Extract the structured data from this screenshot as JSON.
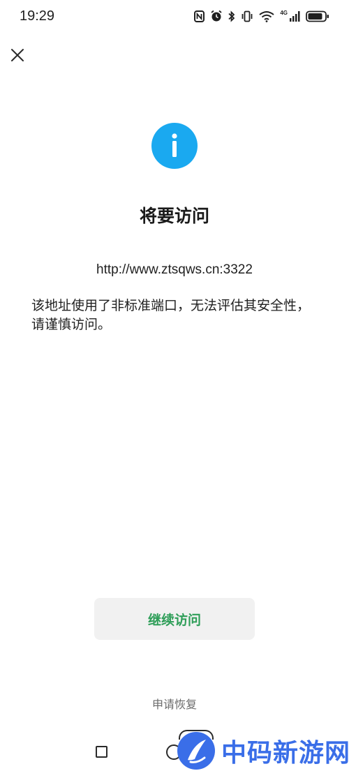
{
  "status_bar": {
    "time": "19:29",
    "network_label": "4G",
    "icons": [
      "nfc-icon",
      "alarm-icon",
      "bluetooth-icon",
      "vibrate-icon",
      "wifi-icon",
      "cellular-signal-icon",
      "battery-icon"
    ]
  },
  "header": {
    "close_icon": "close-icon"
  },
  "dialog": {
    "icon": "info-icon",
    "icon_color": "#1aa9f0",
    "title": "将要访问",
    "url": "http://www.ztsqws.cn:3322",
    "warning": "该地址使用了非标准端口，无法评估其安全性，请谨慎访问。"
  },
  "actions": {
    "continue_label": "继续访问",
    "continue_color": "#2e9e58",
    "appeal_label": "申请恢复"
  },
  "watermark": {
    "text": "中码新游网",
    "color": "#3a6ee8"
  }
}
